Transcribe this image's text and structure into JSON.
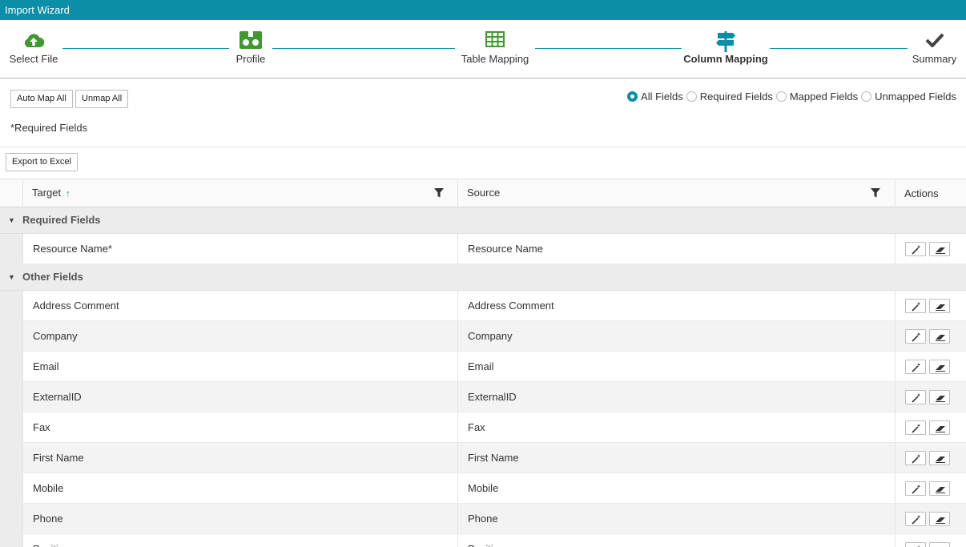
{
  "window": {
    "title": "Import Wizard"
  },
  "steps": [
    {
      "label": "Select File",
      "icon": "cloud-upload-icon"
    },
    {
      "label": "Profile",
      "icon": "profile-icon"
    },
    {
      "label": "Table Mapping",
      "icon": "table-grid-icon"
    },
    {
      "label": "Column Mapping",
      "icon": "signpost-icon",
      "active": true
    },
    {
      "label": "Summary",
      "icon": "checkmark-icon"
    }
  ],
  "toolbar": {
    "auto_map_label": "Auto Map All",
    "unmap_label": "Unmap All",
    "export_label": "Export to Excel"
  },
  "filters": {
    "selected": "All Fields",
    "options": [
      "All Fields",
      "Required Fields",
      "Mapped Fields",
      "Unmapped Fields"
    ]
  },
  "note": "*Required Fields",
  "grid": {
    "columns": {
      "target": "Target",
      "source": "Source",
      "actions": "Actions"
    },
    "groups": [
      {
        "title": "Required Fields",
        "rows": [
          {
            "target": "Resource Name*",
            "source": "Resource Name"
          }
        ]
      },
      {
        "title": "Other Fields",
        "rows": [
          {
            "target": "Address Comment",
            "source": "Address Comment"
          },
          {
            "target": "Company",
            "source": "Company"
          },
          {
            "target": "Email",
            "source": "Email"
          },
          {
            "target": "ExternalID",
            "source": "ExternalID"
          },
          {
            "target": "Fax",
            "source": "Fax"
          },
          {
            "target": "First Name",
            "source": "First Name"
          },
          {
            "target": "Mobile",
            "source": "Mobile"
          },
          {
            "target": "Phone",
            "source": "Phone"
          },
          {
            "target": "Position",
            "source": "Position"
          }
        ]
      }
    ]
  },
  "colors": {
    "accent": "#0b8ea7",
    "step_green": "#3e9a2e"
  }
}
